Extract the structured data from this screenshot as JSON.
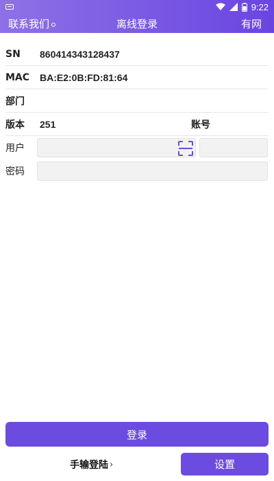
{
  "status_bar": {
    "time": "9:22"
  },
  "header": {
    "contact_label": "联系我们",
    "title": "离线登录",
    "network_status": "有网"
  },
  "info": {
    "sn_label": "SN",
    "sn_value": "860414343128437",
    "mac_label": "MAC",
    "mac_value": "BA:E2:0B:FD:81:64",
    "dept_label": "部门",
    "dept_value": "",
    "version_label": "版本",
    "version_value": "251",
    "account_label": "账号"
  },
  "login_form": {
    "user_label": "用户",
    "user_value": "",
    "account_value": "",
    "password_label": "密码",
    "password_value": ""
  },
  "actions": {
    "login_label": "登录",
    "manual_login_label": "手输登陆",
    "settings_label": "设置"
  },
  "colors": {
    "accent": "#6c4ce0",
    "header_start": "#8e71e6",
    "header_end": "#6a45e1"
  }
}
